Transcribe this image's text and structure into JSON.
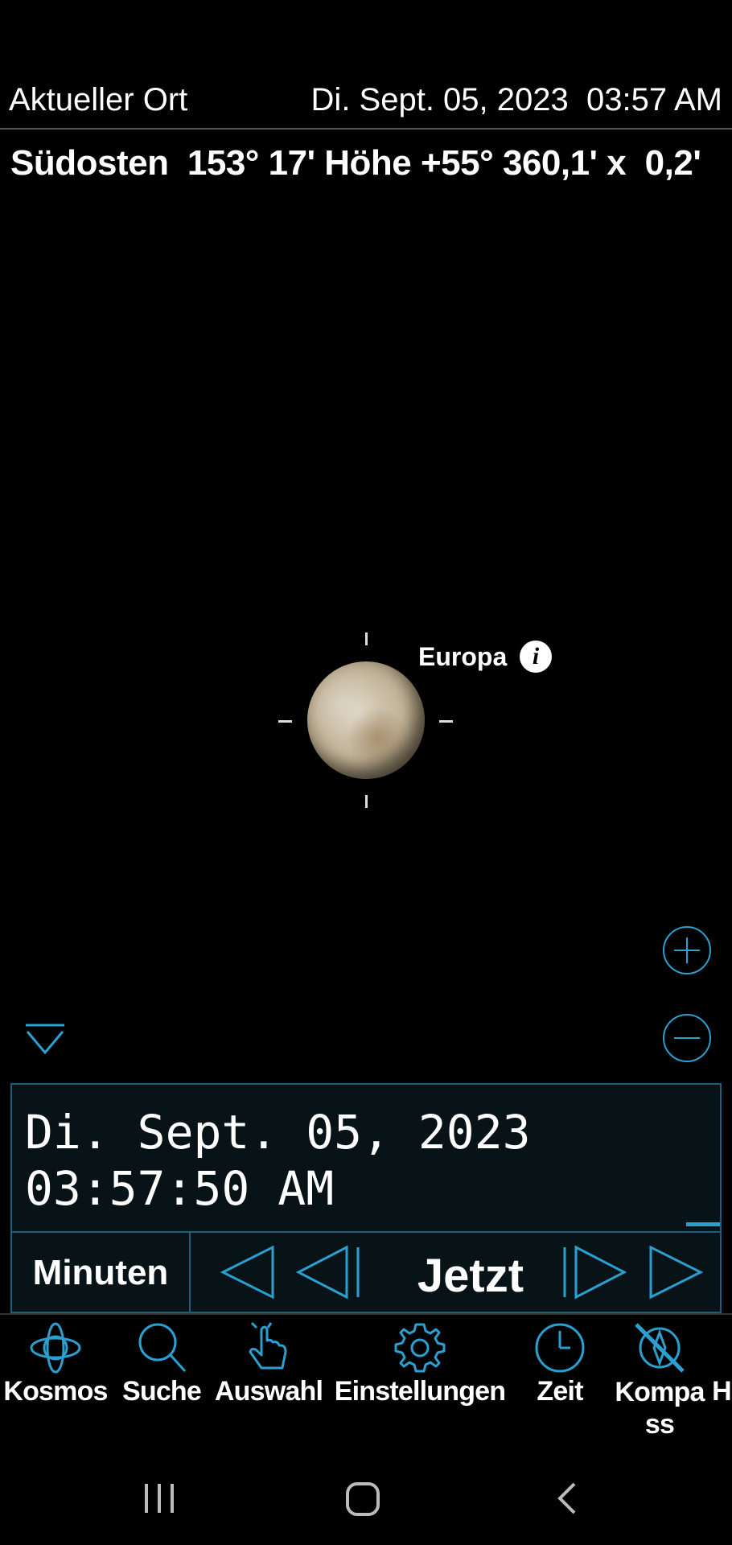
{
  "header": {
    "location": "Aktueller Ort",
    "datetime": "Di. Sept. 05, 2023  03:57 AM",
    "info_line": "Südosten  153° 17' Höhe +55° 360,1' x  0,2'"
  },
  "sky": {
    "object_name": "Europa",
    "info_icon": "info-icon",
    "zoom_in_icon": "plus-circle-icon",
    "zoom_out_icon": "minus-circle-icon",
    "collapse_icon": "chevron-down-icon"
  },
  "time_panel": {
    "date_line": "Di. Sept. 05, 2023",
    "time_line": "03:57:50 AM",
    "unit_label": "Minuten",
    "now_label": "Jetzt",
    "controls": [
      "step-back-icon",
      "skip-back-icon",
      "skip-forward-icon",
      "step-forward-icon"
    ]
  },
  "nav": {
    "items": [
      {
        "label": "Kosmos",
        "icon": "orbit-icon"
      },
      {
        "label": "Suche",
        "icon": "search-icon"
      },
      {
        "label": "Auswahl",
        "icon": "hand-pointer-icon"
      },
      {
        "label": "Einstellungen",
        "icon": "gear-icon"
      },
      {
        "label": "Zeit",
        "icon": "clock-icon"
      },
      {
        "label": "Kompa\nss",
        "icon": "compass-off-icon"
      },
      {
        "label": "H",
        "icon": ""
      }
    ]
  },
  "colors": {
    "accent": "#2aa0d0",
    "panel_border": "#1f5f7c",
    "background": "#000000"
  }
}
